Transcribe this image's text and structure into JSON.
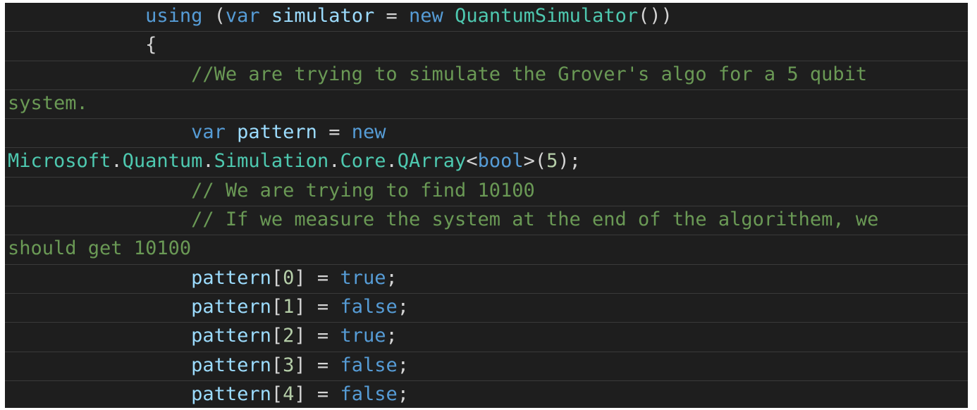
{
  "editor": {
    "colors": {
      "background": "#1e1e1e",
      "keyword": "#569cd6",
      "type": "#4ec9b0",
      "identifier": "#9cdcfe",
      "punctuation": "#d4d4d4",
      "comment": "#6a9955",
      "number": "#b5cea8"
    },
    "lines": [
      {
        "tokens": [
          {
            "t": "            ",
            "c": "pu"
          },
          {
            "t": "using",
            "c": "kw"
          },
          {
            "t": " (",
            "c": "pu"
          },
          {
            "t": "var",
            "c": "kw"
          },
          {
            "t": " ",
            "c": "pu"
          },
          {
            "t": "simulator",
            "c": "id"
          },
          {
            "t": " = ",
            "c": "pu"
          },
          {
            "t": "new",
            "c": "kw"
          },
          {
            "t": " ",
            "c": "pu"
          },
          {
            "t": "QuantumSimulator",
            "c": "ty"
          },
          {
            "t": "())",
            "c": "pu"
          }
        ]
      },
      {
        "tokens": [
          {
            "t": "            {",
            "c": "pu"
          }
        ]
      },
      {
        "tokens": [
          {
            "t": "                ",
            "c": "pu"
          },
          {
            "t": "//We are trying to simulate the Grover's algo for a 5 qubit",
            "c": "cm"
          }
        ]
      },
      {
        "tokens": [
          {
            "t": "system.",
            "c": "cm"
          }
        ]
      },
      {
        "tokens": [
          {
            "t": "                ",
            "c": "pu"
          },
          {
            "t": "var",
            "c": "kw"
          },
          {
            "t": " ",
            "c": "pu"
          },
          {
            "t": "pattern",
            "c": "id"
          },
          {
            "t": " = ",
            "c": "pu"
          },
          {
            "t": "new",
            "c": "kw"
          }
        ]
      },
      {
        "tokens": [
          {
            "t": "Microsoft",
            "c": "ty"
          },
          {
            "t": ".",
            "c": "pu"
          },
          {
            "t": "Quantum",
            "c": "ty"
          },
          {
            "t": ".",
            "c": "pu"
          },
          {
            "t": "Simulation",
            "c": "ty"
          },
          {
            "t": ".",
            "c": "pu"
          },
          {
            "t": "Core",
            "c": "ty"
          },
          {
            "t": ".",
            "c": "pu"
          },
          {
            "t": "QArray",
            "c": "ty"
          },
          {
            "t": "<",
            "c": "pu"
          },
          {
            "t": "bool",
            "c": "kw"
          },
          {
            "t": ">(",
            "c": "pu"
          },
          {
            "t": "5",
            "c": "nu"
          },
          {
            "t": ");",
            "c": "pu"
          }
        ]
      },
      {
        "tokens": [
          {
            "t": "                ",
            "c": "pu"
          },
          {
            "t": "// We are trying to find 10100",
            "c": "cm"
          }
        ]
      },
      {
        "tokens": [
          {
            "t": "                ",
            "c": "pu"
          },
          {
            "t": "// If we measure the system at the end of the algorithem, we",
            "c": "cm"
          }
        ]
      },
      {
        "tokens": [
          {
            "t": "should get 10100",
            "c": "cm"
          }
        ]
      },
      {
        "tokens": [
          {
            "t": "                ",
            "c": "pu"
          },
          {
            "t": "pattern",
            "c": "id"
          },
          {
            "t": "[",
            "c": "pu"
          },
          {
            "t": "0",
            "c": "nu"
          },
          {
            "t": "] = ",
            "c": "pu"
          },
          {
            "t": "true",
            "c": "kw"
          },
          {
            "t": ";",
            "c": "pu"
          }
        ]
      },
      {
        "tokens": [
          {
            "t": "                ",
            "c": "pu"
          },
          {
            "t": "pattern",
            "c": "id"
          },
          {
            "t": "[",
            "c": "pu"
          },
          {
            "t": "1",
            "c": "nu"
          },
          {
            "t": "] = ",
            "c": "pu"
          },
          {
            "t": "false",
            "c": "kw"
          },
          {
            "t": ";",
            "c": "pu"
          }
        ]
      },
      {
        "tokens": [
          {
            "t": "                ",
            "c": "pu"
          },
          {
            "t": "pattern",
            "c": "id"
          },
          {
            "t": "[",
            "c": "pu"
          },
          {
            "t": "2",
            "c": "nu"
          },
          {
            "t": "] = ",
            "c": "pu"
          },
          {
            "t": "true",
            "c": "kw"
          },
          {
            "t": ";",
            "c": "pu"
          }
        ]
      },
      {
        "tokens": [
          {
            "t": "                ",
            "c": "pu"
          },
          {
            "t": "pattern",
            "c": "id"
          },
          {
            "t": "[",
            "c": "pu"
          },
          {
            "t": "3",
            "c": "nu"
          },
          {
            "t": "] = ",
            "c": "pu"
          },
          {
            "t": "false",
            "c": "kw"
          },
          {
            "t": ";",
            "c": "pu"
          }
        ]
      },
      {
        "tokens": [
          {
            "t": "                ",
            "c": "pu"
          },
          {
            "t": "pattern",
            "c": "id"
          },
          {
            "t": "[",
            "c": "pu"
          },
          {
            "t": "4",
            "c": "nu"
          },
          {
            "t": "] = ",
            "c": "pu"
          },
          {
            "t": "false",
            "c": "kw"
          },
          {
            "t": ";",
            "c": "pu"
          }
        ]
      }
    ]
  }
}
